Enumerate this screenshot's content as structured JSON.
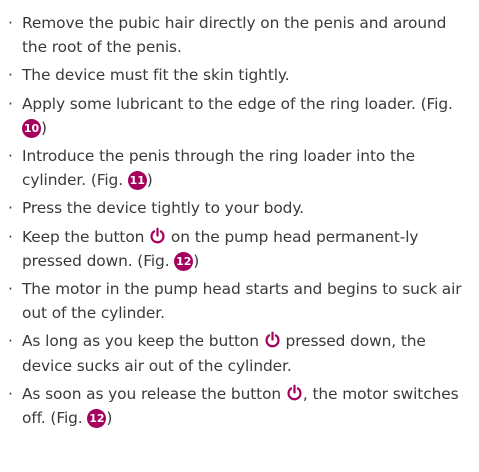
{
  "bullet": "·",
  "accent_color": "#a4005e",
  "items": [
    {
      "text": "Remove the pubic hair directly on the penis and around the root of the penis."
    },
    {
      "text": "The device must fit the skin tightly."
    },
    {
      "text": "Apply some lubricant to the edge of the ring loader. (Fig. ",
      "fig": "10",
      "after": ")"
    },
    {
      "text": "Introduce the penis through the ring loader into the cylinder. (Fig. ",
      "fig": "11",
      "after": ")"
    },
    {
      "text": "Press the device tightly to your body."
    },
    {
      "before": "Keep the button ",
      "icon": "power-icon",
      "text": " on the pump head permanent-ly pressed down. (Fig. ",
      "fig": "12",
      "after": ")"
    },
    {
      "text": "The motor in the pump head starts and begins to suck air out of the cylinder."
    },
    {
      "before": "As long as you keep the button ",
      "icon": "power-icon",
      "text": " pressed down, the device sucks air out of the cylinder."
    },
    {
      "before": "As soon as you release the button ",
      "icon": "power-icon",
      "text": ", the motor switches off. (Fig. ",
      "fig": "12",
      "after": ")"
    }
  ]
}
